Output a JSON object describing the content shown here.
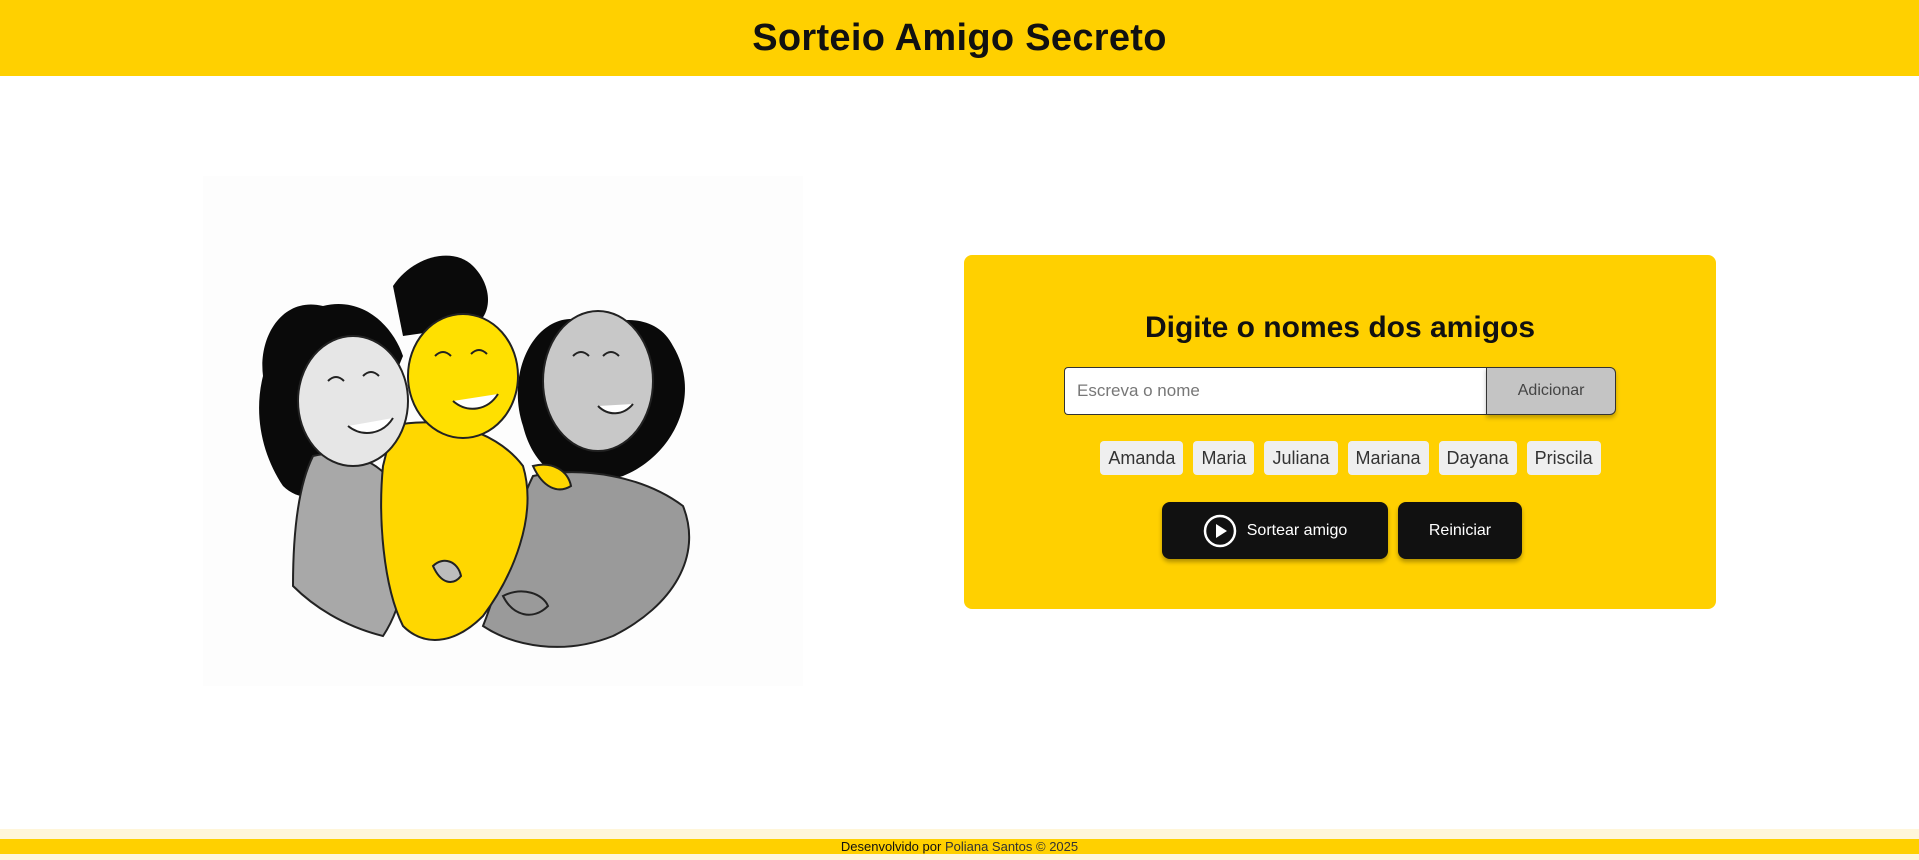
{
  "header": {
    "title": "Sorteio Amigo Secreto"
  },
  "illustration": {
    "icon": "friends-hugging-illustration"
  },
  "card": {
    "title": "Digite o nomes dos amigos",
    "input": {
      "value": "",
      "placeholder": "Escreva o nome"
    },
    "add_button_label": "Adicionar",
    "names": [
      "Amanda",
      "Maria",
      "Juliana",
      "Mariana",
      "Dayana",
      "Priscila"
    ],
    "draw_button_label": "Sortear amigo",
    "draw_button_icon": "play-circle-icon",
    "reset_button_label": "Reiniciar"
  },
  "footer": {
    "prefix": "Desenvolvido por",
    "author": "Poliana Santos © 2025"
  },
  "colors": {
    "accent": "#FFD000",
    "dark": "#111111",
    "chip": "#EFEFEF",
    "add_button": "#C4C4C4"
  }
}
